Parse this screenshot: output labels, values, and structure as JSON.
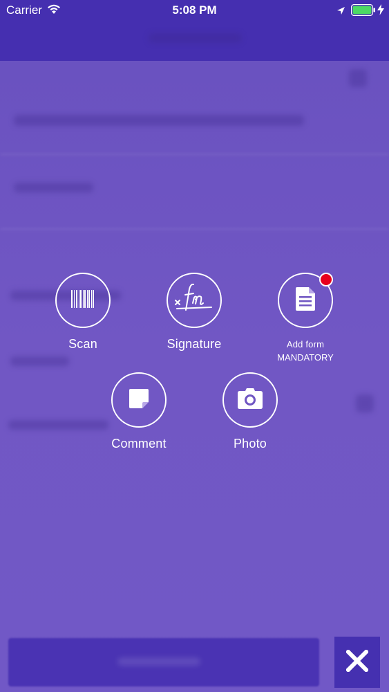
{
  "status_bar": {
    "carrier": "Carrier",
    "time": "5:08 PM"
  },
  "actions": {
    "scan": {
      "label": "Scan",
      "icon": "barcode-icon"
    },
    "signature": {
      "label": "Signature",
      "icon": "signature-icon"
    },
    "add_form": {
      "label": "Add form",
      "sublabel": "MANDATORY",
      "icon": "document-icon",
      "badge_color": "#e8001c"
    },
    "comment": {
      "label": "Comment",
      "icon": "note-icon"
    },
    "photo": {
      "label": "Photo",
      "icon": "camera-icon"
    }
  },
  "close": {
    "icon": "close-icon"
  },
  "colors": {
    "overlay": "#6f55c2",
    "header": "#452fb0",
    "badge": "#e8001c"
  }
}
